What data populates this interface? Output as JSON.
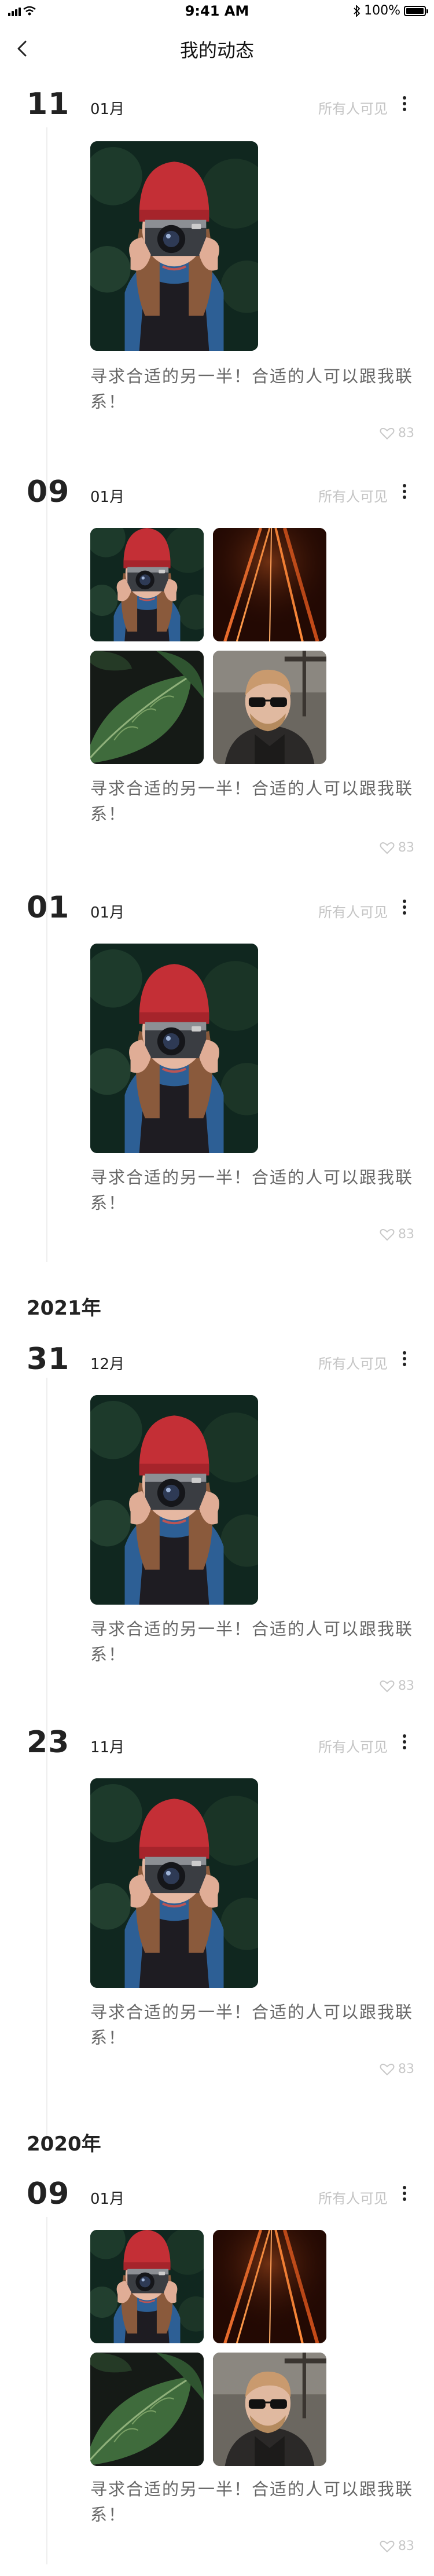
{
  "status_bar": {
    "time": "9:41 AM",
    "battery": "100%"
  },
  "nav": {
    "title": "我的动态"
  },
  "like_icon": "heart-outline-icon",
  "posts": [
    {
      "day": "11",
      "month": "01月",
      "visibility": "所有人可见",
      "text": "寻求合适的另一半！合适的人可以跟我联系！",
      "likes": "83",
      "images": [
        "camera-girl"
      ]
    },
    {
      "day": "09",
      "month": "01月",
      "visibility": "所有人可见",
      "text": "寻求合适的另一半！合适的人可以跟我联系！",
      "likes": "83",
      "images": [
        "camera-girl",
        "light-streaks",
        "green-leaf",
        "man-sunglasses"
      ]
    },
    {
      "day": "01",
      "month": "01月",
      "visibility": "所有人可见",
      "text": "寻求合适的另一半！合适的人可以跟我联系！",
      "likes": "83",
      "images": [
        "camera-girl"
      ]
    },
    {
      "day": "31",
      "month": "12月",
      "visibility": "所有人可见",
      "text": "寻求合适的另一半！合适的人可以跟我联系！",
      "likes": "83",
      "images": [
        "camera-girl"
      ]
    },
    {
      "day": "23",
      "month": "11月",
      "visibility": "所有人可见",
      "text": "寻求合适的另一半！合适的人可以跟我联系！",
      "likes": "83",
      "images": [
        "camera-girl"
      ]
    },
    {
      "day": "09",
      "month": "01月",
      "visibility": "所有人可见",
      "text": "寻求合适的另一半！合适的人可以跟我联系！",
      "likes": "83",
      "images": [
        "camera-girl",
        "light-streaks",
        "green-leaf",
        "man-sunglasses"
      ]
    }
  ],
  "years": [
    "2021年",
    "2020年"
  ]
}
